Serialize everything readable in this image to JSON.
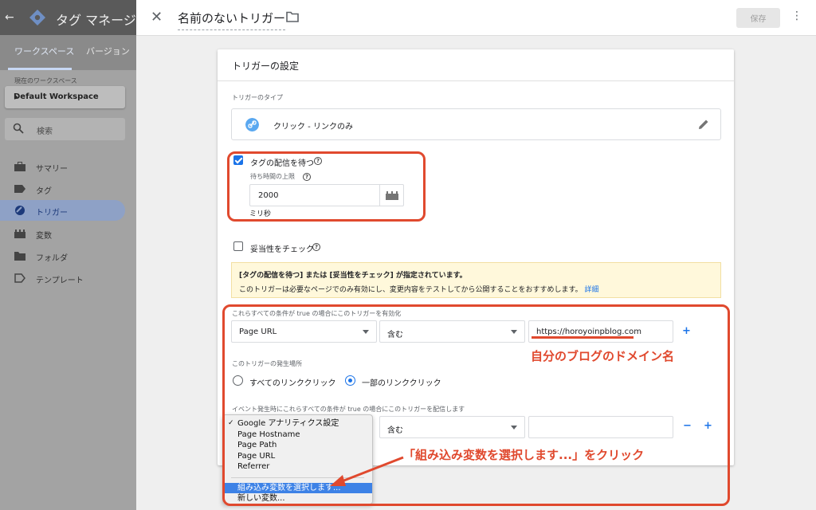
{
  "app": {
    "title": "タグ マネージャー",
    "tabs": [
      "ワークスペース",
      "バージョン"
    ],
    "current_workspace_label": "現在のワークスペース",
    "workspace_name": "Default Workspace",
    "search_placeholder": "検索",
    "nav": [
      {
        "label": "サマリー",
        "icon": "briefcase-icon"
      },
      {
        "label": "タグ",
        "icon": "tag-icon"
      },
      {
        "label": "トリガー",
        "icon": "trigger-icon",
        "active": true
      },
      {
        "label": "変数",
        "icon": "variable-icon"
      },
      {
        "label": "フォルダ",
        "icon": "folder-icon"
      },
      {
        "label": "テンプレート",
        "icon": "template-icon"
      }
    ]
  },
  "panel": {
    "trigger_name": "名前のないトリガー",
    "save_label": "保存"
  },
  "card": {
    "title": "トリガーの設定",
    "type_label": "トリガーのタイプ",
    "type_value": "クリック - リンクのみ",
    "wait_for_tags": {
      "label": "タグの配信を待つ",
      "checked": true
    },
    "max_wait_label": "待ち時間の上限",
    "max_wait_value": "2000",
    "max_wait_unit": "ミリ秒",
    "check_validation": {
      "label": "妥当性をチェック",
      "checked": false
    },
    "notice_line1": "[タグの配信を待つ] または [妥当性をチェック] が指定されています。",
    "notice_line2": "このトリガーは必要なページでのみ有効にし、変更内容をテストしてから公開することをおすすめします。",
    "notice_link": "詳細",
    "enable_conditions_label": "これらすべての条件が true の場合にこのトリガーを有効化",
    "enable_condition": {
      "variable": "Page URL",
      "operator": "含む",
      "value": "https://horoyoinpblog.com"
    },
    "fires_on_label": "このトリガーの発生場所",
    "fires_on_options": [
      {
        "label": "すべてのリンククリック",
        "selected": false
      },
      {
        "label": "一部のリンククリック",
        "selected": true
      }
    ],
    "fire_conditions_label": "イベント発生時にこれらすべての条件が true の場合にこのトリガーを配信します",
    "fire_condition": {
      "operator": "含む",
      "value": ""
    }
  },
  "menu": {
    "items": [
      {
        "label": "Google アナリティクス設定",
        "checked": true
      },
      {
        "label": "Page Hostname"
      },
      {
        "label": "Page Path"
      },
      {
        "label": "Page URL"
      },
      {
        "label": "Referrer"
      },
      {
        "label": "組み込み変数を選択します...",
        "highlighted": true
      },
      {
        "label": "新しい変数..."
      }
    ]
  },
  "annotations": {
    "domain_note": "自分のブログのドメイン名",
    "click_note": "「組み込み変数を選択します...」をクリック",
    "color": "#e0492e"
  }
}
